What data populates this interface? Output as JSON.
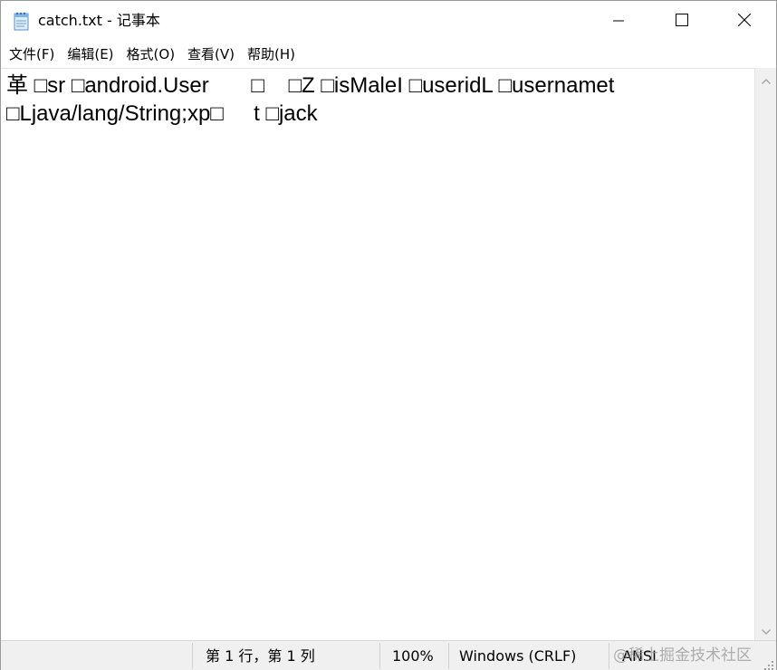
{
  "window": {
    "title": "catch.txt - 记事本"
  },
  "menu": {
    "items": [
      "文件(F)",
      "编辑(E)",
      "格式(O)",
      "查看(V)",
      "帮助(H)"
    ]
  },
  "editor": {
    "lines": [
      "革 □sr □android.User       □    □Z □isMaleI □useridL □usernamet",
      "□Ljava/lang/String;xp□     t □jack"
    ]
  },
  "status": {
    "position": "第 1 行，第 1 列",
    "zoom": "100%",
    "line_ending": "Windows (CRLF)",
    "encoding": "ANSI"
  },
  "watermark": {
    "text": "@稀土掘金技术社区"
  },
  "icons": {
    "app": "notepad-icon",
    "minimize": "minimize-icon",
    "maximize": "maximize-icon",
    "close": "close-icon",
    "scroll_up": "chevron-up-icon",
    "scroll_down": "chevron-down-icon",
    "resize": "resize-grip-icon"
  }
}
